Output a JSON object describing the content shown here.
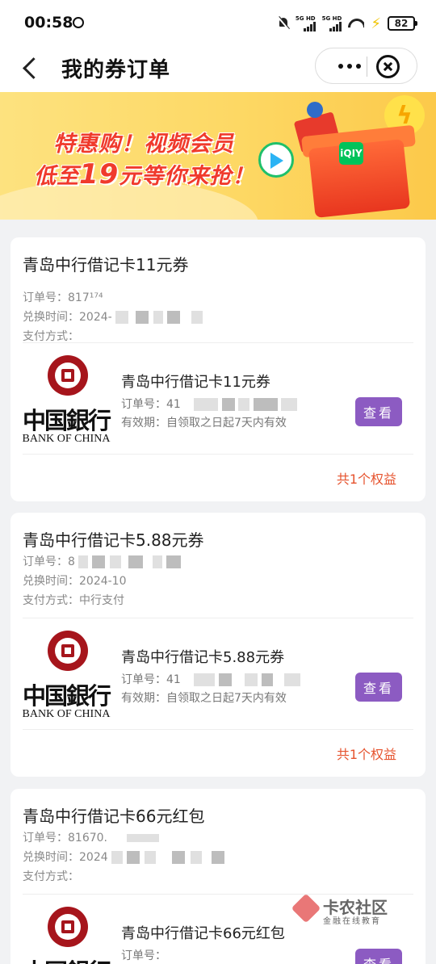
{
  "status_bar": {
    "time": "00:58",
    "net1": "5G HD",
    "net2": "5G HD",
    "battery": "82"
  },
  "nav": {
    "title": "我的券订单"
  },
  "banner": {
    "line1": "特惠购！视频会员",
    "line2_pre": "低至",
    "line2_num": "19",
    "line2_post": "元等你来抢！",
    "iq_logo": "iQIY"
  },
  "labels": {
    "order_no": "订单号：",
    "exchange_time": "兑换时间：",
    "pay_method": "支付方式：",
    "validity": "有效期：",
    "view": "查看"
  },
  "bank": {
    "cn": "中国銀行",
    "en": "BANK OF CHINA"
  },
  "orders": [
    {
      "title": "青岛中行借记卡11元券",
      "order_no": "817¹⁷⁴",
      "exchange_time": "2024-",
      "pay_method": "",
      "item_name": "青岛中行借记卡11元券",
      "item_order_no": "41",
      "validity": "自领取之日起7天内有效",
      "benefit_count": "共1个权益"
    },
    {
      "title": "青岛中行借记卡5.88元券",
      "order_no": "8",
      "exchange_time": "2024-10",
      "pay_method": "中行支付",
      "item_name": "青岛中行借记卡5.88元券",
      "item_order_no": "41",
      "validity": "自领取之日起7天内有效",
      "benefit_count": "共1个权益"
    },
    {
      "title": "青岛中行借记卡66元红包",
      "order_no": "81670.",
      "exchange_time": "2024",
      "pay_method": "",
      "item_name": "青岛中行借记卡66元红包",
      "item_order_no": "",
      "validity": "",
      "benefit_count": ""
    }
  ],
  "watermark": {
    "title": "卡农社区",
    "subtitle": "金融在线教育"
  }
}
